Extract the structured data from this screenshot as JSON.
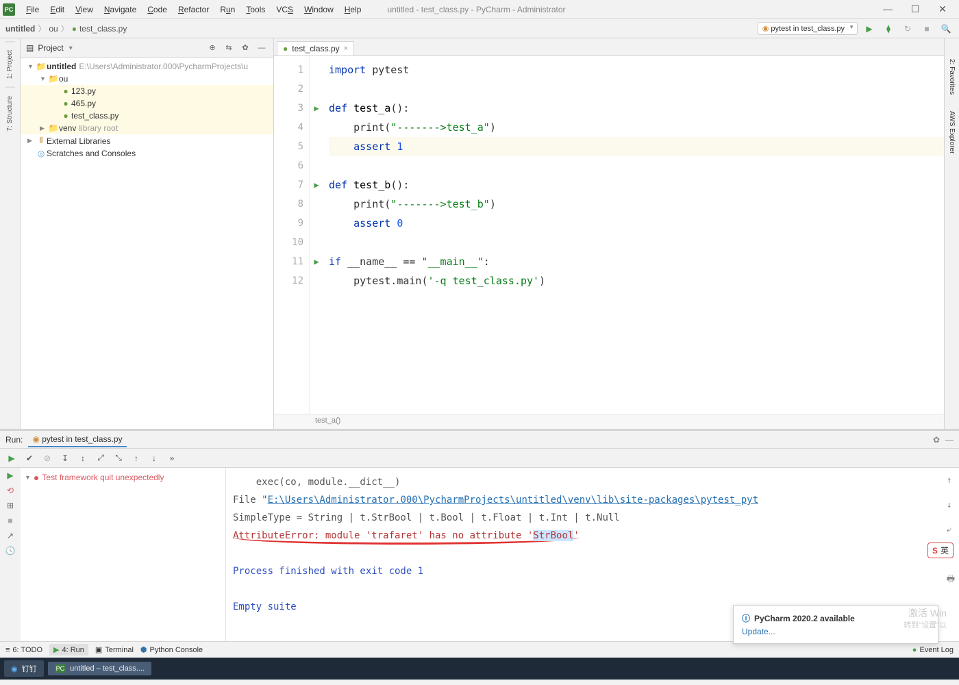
{
  "window": {
    "title": "untitled - test_class.py - PyCharm - Administrator",
    "logo": "PC"
  },
  "menu": [
    "File",
    "Edit",
    "View",
    "Navigate",
    "Code",
    "Refactor",
    "Run",
    "Tools",
    "VCS",
    "Window",
    "Help"
  ],
  "breadcrumb": [
    "untitled",
    "ou",
    "test_class.py"
  ],
  "run_config": "pytest in test_class.py",
  "left_tabs": [
    "1: Project",
    "7: Structure"
  ],
  "project_panel": {
    "title": "Project",
    "tree": {
      "root": {
        "name": "untitled",
        "path": "E:\\Users\\Administrator.000\\PycharmProjects\\u"
      },
      "folder_ou": "ou",
      "files": [
        "123.py",
        "465.py",
        "test_class.py"
      ],
      "venv": {
        "name": "venv",
        "note": "library root"
      },
      "ext_libs": "External Libraries",
      "scratches": "Scratches and Consoles"
    }
  },
  "editor": {
    "tab": "test_class.py",
    "lines": [
      "1",
      "2",
      "3",
      "4",
      "5",
      "6",
      "7",
      "8",
      "9",
      "10",
      "11",
      "12"
    ],
    "code": {
      "l1": [
        "import",
        " pytest"
      ],
      "l3": [
        "def ",
        "test_a",
        "():"
      ],
      "l4a": "print(",
      "l4b": "\"------->test_a\"",
      "l4c": ")",
      "l5a": "assert ",
      "l5b": "1",
      "l7": [
        "def ",
        "test_b",
        "():"
      ],
      "l8a": "print(",
      "l8b": "\"------->test_b\"",
      "l8c": ")",
      "l9a": "assert ",
      "l9b": "0",
      "l11a": "if ",
      "l11b": "__name__",
      "l11c": " == ",
      "l11d": "\"__main__\"",
      "l11e": ":",
      "l12a": "pytest.main(",
      "l12b": "'-q test_class.py'",
      "l12c": ")"
    },
    "breadcrumb_fn": "test_a()"
  },
  "run_panel": {
    "label": "Run:",
    "tab": "pytest in test_class.py",
    "tree_msg": "Test framework quit unexpectedly",
    "console": {
      "exec": "exec(co, module.__dict__)",
      "file_lbl": "  File \"",
      "file_link": "E:\\Users\\Administrator.000\\PycharmProjects\\untitled\\venv\\lib\\site-packages\\pytest_pyt",
      "simple": "    SimpleType = String | t.StrBool | t.Bool | t.Float | t.Int | t.Null",
      "err1": "AttributeError: module 'trafaret' has no attribute '",
      "err_hl": "StrBool",
      "err2": "'",
      "exit": "Process finished with exit code 1",
      "empty": "Empty suite"
    }
  },
  "status": {
    "todo": "6: TODO",
    "run": "4: Run",
    "terminal": "Terminal",
    "pyconsole": "Python Console",
    "eventlog": "Event Log"
  },
  "notif": {
    "title": "PyCharm 2020.2 available",
    "link": "Update..."
  },
  "ime": {
    "lang": "英"
  },
  "watermark": {
    "l1": "激活 Win",
    "l2": "转到\"设置\"以"
  },
  "taskbar": {
    "item1": "钉钉",
    "item2": "untitled – test_class...."
  },
  "right_tabs": [
    "2: Favorites",
    "AWS Explorer"
  ]
}
